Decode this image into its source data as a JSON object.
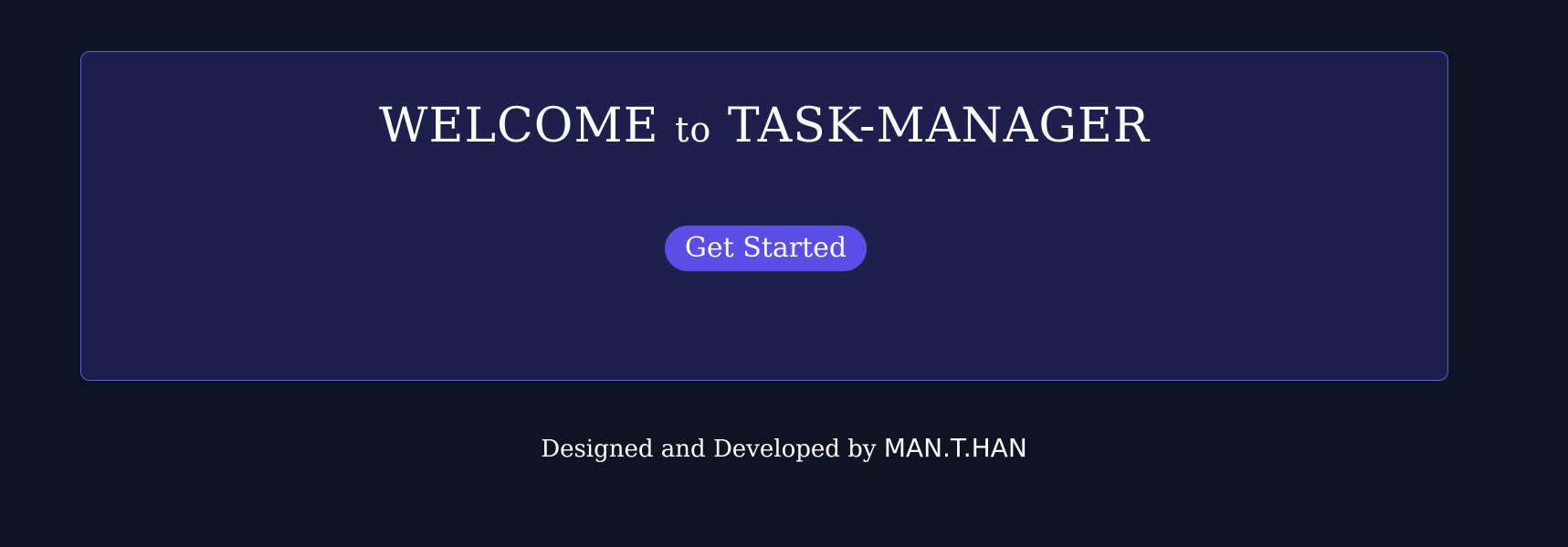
{
  "hero": {
    "title_part1": "WELCOME",
    "title_part2": "to",
    "title_part3": "TASK-MANAGER",
    "button_label": "Get Started"
  },
  "footer": {
    "text": "Designed and Developed by",
    "author": "MAN.T.HAN"
  },
  "colors": {
    "page_background": "#0f1424",
    "card_background": "#1e1f4d",
    "card_border": "#5b5fd0",
    "button_background": "#5a4ee6",
    "text": "#ffffff"
  }
}
